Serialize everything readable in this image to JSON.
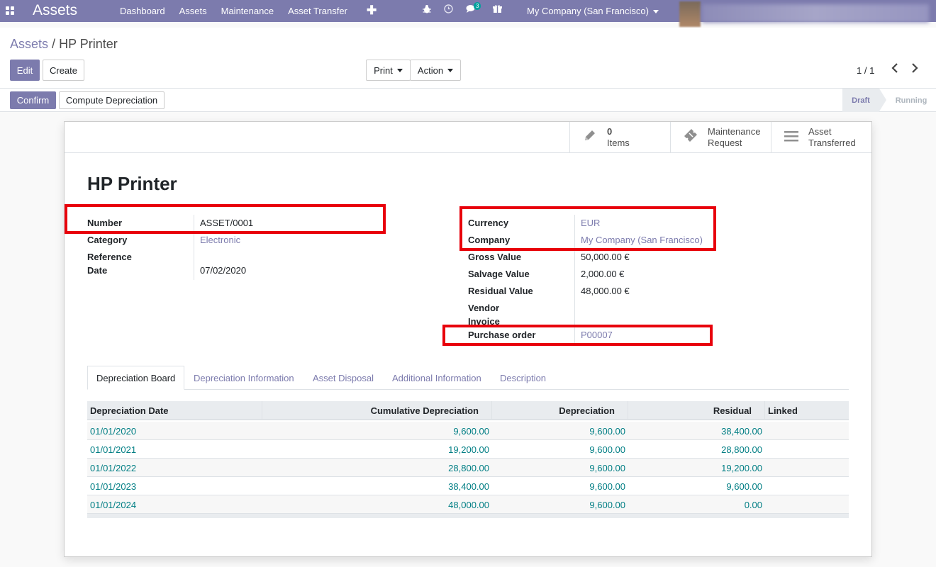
{
  "navbar": {
    "app_title": "Assets",
    "menu": [
      "Dashboard",
      "Assets",
      "Maintenance",
      "Asset Transfer"
    ],
    "add_icon": "plus-icon",
    "messages_count": "3",
    "company": "My Company (San Francisco)"
  },
  "breadcrumb": {
    "parent": "Assets",
    "separator": "/",
    "current": "HP Printer"
  },
  "toolbar": {
    "edit": "Edit",
    "create": "Create",
    "print": "Print",
    "action": "Action",
    "pager": "1 / 1"
  },
  "statusbar": {
    "confirm": "Confirm",
    "compute": "Compute Depreciation",
    "stages": [
      "Draft",
      "Running"
    ],
    "active_stage": "Draft"
  },
  "smart_buttons": [
    {
      "icon": "pencil-icon",
      "line1": "0",
      "line2": "Items"
    },
    {
      "icon": "ticket-icon",
      "line1": "Maintenance",
      "line2": "Request"
    },
    {
      "icon": "list-icon",
      "line1": "Asset",
      "line2": "Transferred"
    }
  ],
  "record": {
    "title": "HP Printer",
    "left": {
      "number_label": "Number",
      "number": "ASSET/0001",
      "category_label": "Category",
      "category": "Electronic",
      "date_label_1": "Reference",
      "date_label_2": "Date",
      "date": "07/02/2020"
    },
    "right": {
      "currency_label": "Currency",
      "currency": "EUR",
      "company_label": "Company",
      "company": "My Company (San Francisco)",
      "gross_label": "Gross Value",
      "gross": "50,000.00 €",
      "salvage_label": "Salvage Value",
      "salvage": "2,000.00 €",
      "residual_label": "Residual Value",
      "residual": "48,000.00 €",
      "vendor_label_1": "Vendor",
      "vendor_label_2": "Invoice",
      "po_label": "Purchase order",
      "po": "P00007"
    }
  },
  "tabs": [
    "Depreciation Board",
    "Depreciation Information",
    "Asset Disposal",
    "Additional Information",
    "Description"
  ],
  "table": {
    "headers": [
      "Depreciation Date",
      "Cumulative Depreciation",
      "Depreciation",
      "Residual",
      "Linked"
    ],
    "rows": [
      [
        "01/01/2020",
        "9,600.00",
        "9,600.00",
        "38,400.00"
      ],
      [
        "01/01/2021",
        "19,200.00",
        "9,600.00",
        "28,800.00"
      ],
      [
        "01/01/2022",
        "28,800.00",
        "9,600.00",
        "19,200.00"
      ],
      [
        "01/01/2023",
        "38,400.00",
        "9,600.00",
        "9,600.00"
      ],
      [
        "01/01/2024",
        "48,000.00",
        "9,600.00",
        "0.00"
      ]
    ]
  },
  "colors": {
    "brand": "#7c7bad",
    "link_teal": "#017e84",
    "highlight_red": "#e8000b"
  }
}
